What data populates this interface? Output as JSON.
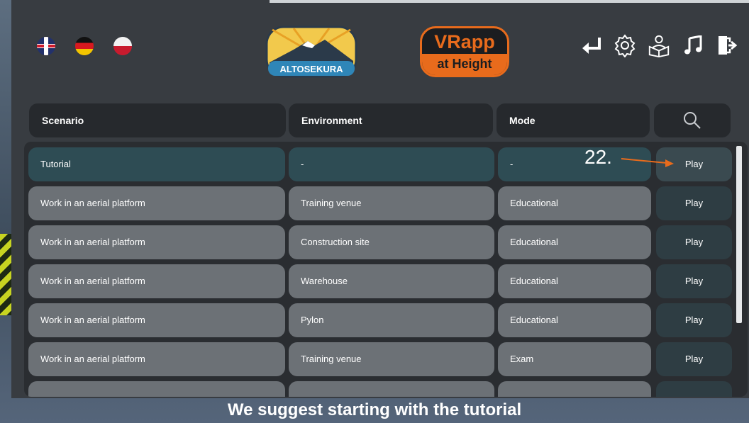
{
  "colors": {
    "accent": "#e86b1c",
    "panel": "#383c41",
    "row_grey": "#6c7176",
    "row_selected": "#2e4c54"
  },
  "header": {
    "languages": [
      {
        "code": "en",
        "icon": "uk-flag-icon"
      },
      {
        "code": "de",
        "icon": "germany-flag-icon"
      },
      {
        "code": "pl",
        "icon": "poland-flag-icon"
      }
    ],
    "logo_left": {
      "text": "ALTOSEKURA"
    },
    "logo_right": {
      "title": "VRapp",
      "subtitle": "at Height"
    },
    "toolbar_icons": [
      "return-icon",
      "settings-icon",
      "user-manual-icon",
      "music-icon",
      "exit-icon"
    ]
  },
  "table": {
    "columns": [
      "Scenario",
      "Environment",
      "Mode"
    ],
    "search_icon": "search-icon",
    "rows": [
      {
        "scenario": "Tutorial",
        "environment": "-",
        "mode": "-",
        "action": "Play",
        "selected": true
      },
      {
        "scenario": "Work in an aerial platform",
        "environment": "Training venue",
        "mode": "Educational",
        "action": "Play"
      },
      {
        "scenario": "Work in an aerial platform",
        "environment": "Construction site",
        "mode": "Educational",
        "action": "Play"
      },
      {
        "scenario": "Work in an aerial platform",
        "environment": "Warehouse",
        "mode": "Educational",
        "action": "Play"
      },
      {
        "scenario": "Work in an aerial platform",
        "environment": "Pylon",
        "mode": "Educational",
        "action": "Play"
      },
      {
        "scenario": "Work in an aerial platform",
        "environment": "Training venue",
        "mode": "Exam",
        "action": "Play"
      },
      {
        "scenario": "",
        "environment": "",
        "mode": "",
        "action": ""
      }
    ]
  },
  "annotation": {
    "label": "22."
  },
  "footer": {
    "text": "We suggest starting with the tutorial"
  }
}
